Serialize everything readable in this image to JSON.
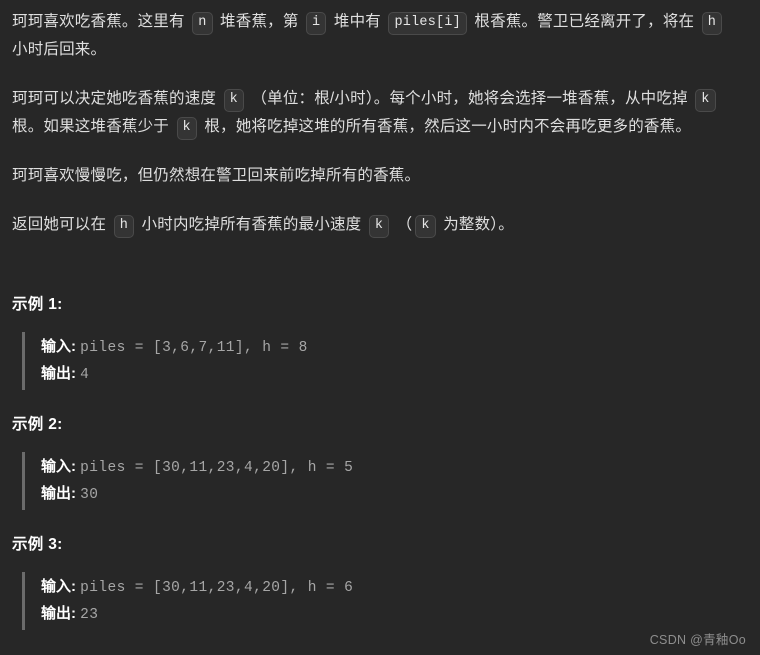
{
  "background_color": "#272727",
  "text_color": "#dfdfdf",
  "chip_bg_color": "#343434",
  "chip_border_color": "#4a4a4a",
  "quote_border_color": "#6b6b6b",
  "code_color": "#a6a6a6",
  "paragraphs": [
    {
      "id": "problem-statement",
      "parts": [
        {
          "type": "text",
          "value": "珂珂喜欢吃香蕉。这里有 "
        },
        {
          "type": "code",
          "value": "n"
        },
        {
          "type": "text",
          "value": " 堆香蕉，第 "
        },
        {
          "type": "code",
          "value": "i"
        },
        {
          "type": "text",
          "value": " 堆中有 "
        },
        {
          "type": "code",
          "value": "piles[i]"
        },
        {
          "type": "text",
          "value": " 根香蕉。警卫已经离开了，将在 "
        },
        {
          "type": "code",
          "value": "h"
        },
        {
          "type": "text",
          "value": " 小时后回来。"
        }
      ]
    },
    {
      "id": "eating-speed-rules",
      "parts": [
        {
          "type": "text",
          "value": "珂珂可以决定她吃香蕉的速度 "
        },
        {
          "type": "code",
          "value": "k"
        },
        {
          "type": "text",
          "value": " （单位：根/小时）。每个小时，她将会选择一堆香蕉，从中吃掉 "
        },
        {
          "type": "code",
          "value": "k"
        },
        {
          "type": "text",
          "value": " 根。如果这堆香蕉少于 "
        },
        {
          "type": "code",
          "value": "k"
        },
        {
          "type": "text",
          "value": " 根，她将吃掉这堆的所有香蕉，然后这一小时内不会再吃更多的香蕉。"
        }
      ]
    },
    {
      "id": "slow-eating-note",
      "parts": [
        {
          "type": "text",
          "value": "珂珂喜欢慢慢吃，但仍然想在警卫回来前吃掉所有的香蕉。"
        }
      ]
    },
    {
      "id": "return-requirement",
      "parts": [
        {
          "type": "text",
          "value": "返回她可以在 "
        },
        {
          "type": "code",
          "value": "h"
        },
        {
          "type": "text",
          "value": " 小时内吃掉所有香蕉的最小速度 "
        },
        {
          "type": "code",
          "value": "k"
        },
        {
          "type": "text",
          "value": " （"
        },
        {
          "type": "code",
          "value": "k"
        },
        {
          "type": "text",
          "value": " 为整数）。"
        }
      ]
    }
  ],
  "examples": [
    {
      "title": "示例 1:",
      "input_label": "输入:",
      "input_value": "piles = [3,6,7,11], h = 8",
      "output_label": "输出:",
      "output_value": "4"
    },
    {
      "title": "示例 2:",
      "input_label": "输入:",
      "input_value": "piles = [30,11,23,4,20], h = 5",
      "output_label": "输出:",
      "output_value": "30"
    },
    {
      "title": "示例 3:",
      "input_label": "输入:",
      "input_value": "piles = [30,11,23,4,20], h = 6",
      "output_label": "输出:",
      "output_value": "23"
    }
  ],
  "watermark": "CSDN @青釉Oo"
}
